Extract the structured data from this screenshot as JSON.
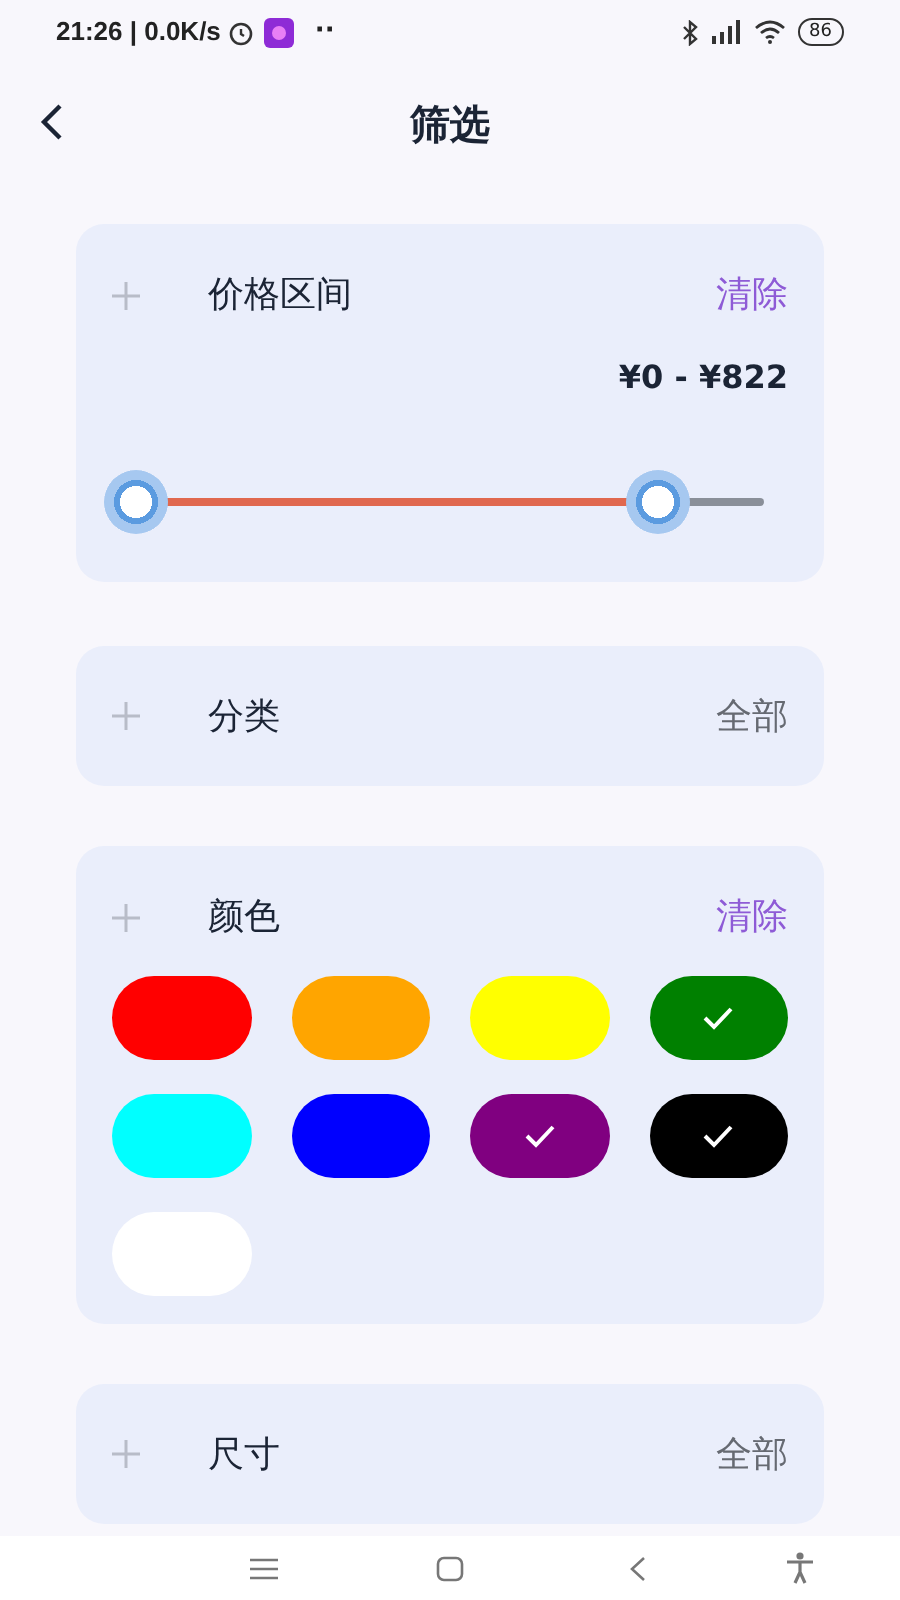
{
  "status_bar": {
    "time": "21:26 | 0.0K/s",
    "more": "··",
    "battery": "86"
  },
  "header": {
    "title": "筛选"
  },
  "price": {
    "title": "价格区间",
    "clear": "清除",
    "range": "¥0 - ¥822",
    "low": {
      "level": 0
    },
    "high": {
      "level": 0.83
    }
  },
  "category": {
    "title": "分类",
    "value": "全部"
  },
  "colors": {
    "title": "颜色",
    "clear": "清除",
    "swatches": [
      {
        "color": "#ff0000",
        "selected": false
      },
      {
        "color": "#ffa500",
        "selected": false
      },
      {
        "color": "#ffff00",
        "selected": false
      },
      {
        "color": "#008000",
        "selected": true
      },
      {
        "color": "#00ffff",
        "selected": false
      },
      {
        "color": "#0000ff",
        "selected": false
      },
      {
        "color": "#800080",
        "selected": true
      },
      {
        "color": "#000000",
        "selected": true
      },
      {
        "color": "#ffffff",
        "selected": false
      }
    ]
  },
  "size": {
    "title": "尺寸",
    "value": "全部"
  }
}
